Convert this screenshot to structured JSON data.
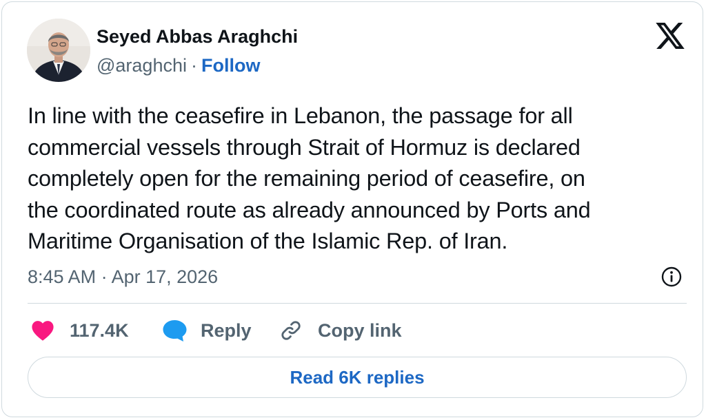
{
  "author": {
    "name": "Seyed Abbas Araghchi",
    "handle": "@araghchi",
    "separator": "·",
    "follow_label": "Follow"
  },
  "tweet": {
    "lines": [
      "In line with the ceasefire in Lebanon, the passage for all",
      "commercial vessels through Strait of Hormuz is declared",
      "completely open for the remaining period of ceasefire, on",
      "the coordinated route as already announced by Ports and",
      "Maritime Organisation of the Islamic Rep. of Iran."
    ],
    "timestamp": "8:45 AM · Apr 17, 2026"
  },
  "actions": {
    "like_count": "117.4K",
    "reply_label": "Reply",
    "copy_link_label": "Copy link"
  },
  "read_replies_label": "Read 6K replies",
  "icons": {
    "brand": "x-logo-icon",
    "info": "info-icon",
    "like": "heart-icon",
    "reply": "speech-bubble-icon",
    "copy": "link-icon"
  },
  "colors": {
    "accent": "#1d68c4",
    "like": "#f91880",
    "reply": "#1d9bf0",
    "muted": "#536471",
    "text": "#0f1419",
    "border": "#cfd9de"
  }
}
